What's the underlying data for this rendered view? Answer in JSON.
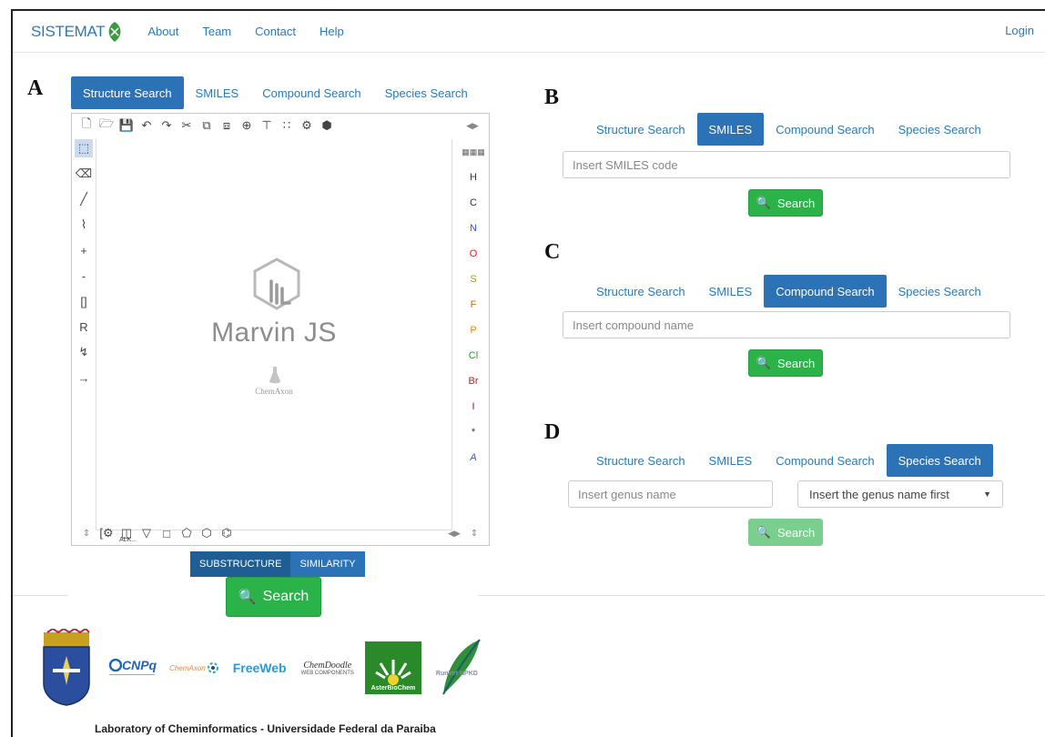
{
  "navbar": {
    "brand": "SISTEMAT",
    "links": [
      "About",
      "Team",
      "Contact",
      "Help"
    ],
    "login": "Login"
  },
  "panels": {
    "A": {
      "letter": "A",
      "tabs": [
        "Structure Search",
        "SMILES",
        "Compound Search",
        "Species Search"
      ],
      "active_tab": "Structure Search",
      "editor": {
        "product": "Marvin JS",
        "vendor": "ChemAxon",
        "elements": [
          "H",
          "C",
          "N",
          "O",
          "S",
          "F",
          "P",
          "Cl",
          "Br",
          "I",
          "*",
          "A"
        ],
        "element_colors": [
          "#555555",
          "#555555",
          "#3050f8",
          "#ff0d0d",
          "#a0a000",
          "#c0701a",
          "#ff8000",
          "#1fa01f",
          "#a62929",
          "#940094",
          "#555555",
          "#3050f8"
        ],
        "alk_label": "ALK..."
      },
      "mode_buttons": [
        "SUBSTRUCTURE",
        "SIMILARITY"
      ],
      "search_button": "Search"
    },
    "B": {
      "letter": "B",
      "tabs": [
        "Structure Search",
        "SMILES",
        "Compound Search",
        "Species Search"
      ],
      "active_tab": "SMILES",
      "input_placeholder": "Insert SMILES code",
      "search_button": "Search"
    },
    "C": {
      "letter": "C",
      "tabs": [
        "Structure Search",
        "SMILES",
        "Compound Search",
        "Species Search"
      ],
      "active_tab": "Compound Search",
      "input_placeholder": "Insert compound name",
      "search_button": "Search"
    },
    "D": {
      "letter": "D",
      "tabs": [
        "Structure Search",
        "SMILES",
        "Compound Search",
        "Species Search"
      ],
      "active_tab": "Species Search",
      "genus_placeholder": "Insert genus name",
      "select_value": "Insert the genus name first",
      "search_button": "Search"
    }
  },
  "logos": {
    "cnpq": "CNPq",
    "chemaxon": "ChemAxon",
    "freeweb": "FreeWeb",
    "chemdoodle": "ChemDoodle",
    "chemdoodle_sub": "WEB COMPONENTS",
    "asterbiochem": "AsterBioChem",
    "runvet": "RunVet NPKD"
  },
  "footer": "Laboratory of Cheminformatics - Universidade Federal da Paraiba",
  "colors": {
    "primary": "#2b72b6",
    "link": "#2a7ab8",
    "success": "#2bb34a"
  }
}
